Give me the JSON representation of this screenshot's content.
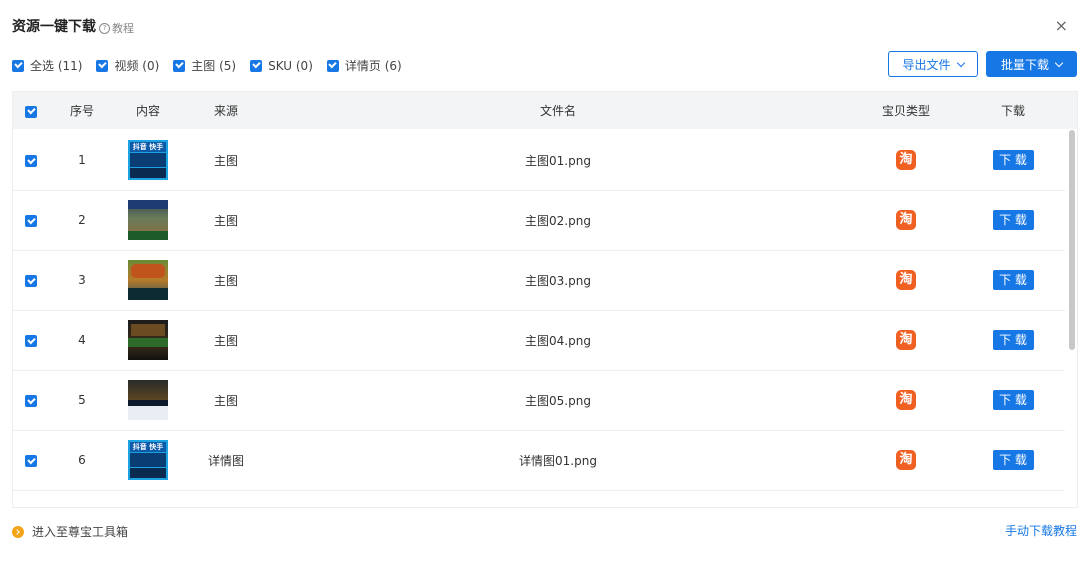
{
  "header": {
    "title": "资源一键下载",
    "help_label": "教程",
    "close_glyph": "×"
  },
  "filters": [
    {
      "label": "全选 (11)",
      "checked": true
    },
    {
      "label": "视频 (0)",
      "checked": true
    },
    {
      "label": "主图 (5)",
      "checked": true
    },
    {
      "label": "SKU (0)",
      "checked": true
    },
    {
      "label": "详情页 (6)",
      "checked": true
    }
  ],
  "toolbar": {
    "export_label": "导出文件",
    "batch_label": "批量下载"
  },
  "table": {
    "columns": [
      "序号",
      "内容",
      "来源",
      "文件名",
      "宝贝类型",
      "下载"
    ],
    "rows": [
      {
        "index": "1",
        "thumb": "promo-blue",
        "source": "主图",
        "filename": "主图01.png",
        "type_icon": "淘",
        "download": "下 载"
      },
      {
        "index": "2",
        "thumb": "photo-scene",
        "source": "主图",
        "filename": "主图02.png",
        "type_icon": "淘",
        "download": "下 载"
      },
      {
        "index": "3",
        "thumb": "food-scene",
        "source": "主图",
        "filename": "主图03.png",
        "type_icon": "淘",
        "download": "下 载"
      },
      {
        "index": "4",
        "thumb": "dark-scene",
        "source": "主图",
        "filename": "主图04.png",
        "type_icon": "淘",
        "download": "下 载"
      },
      {
        "index": "5",
        "thumb": "board-scene",
        "source": "主图",
        "filename": "主图05.png",
        "type_icon": "淘",
        "download": "下 载"
      },
      {
        "index": "6",
        "thumb": "promo-blue",
        "source": "详情图",
        "filename": "详情图01.png",
        "type_icon": "淘",
        "download": "下 载"
      }
    ]
  },
  "footer": {
    "toolbox_link": "进入至尊宝工具箱",
    "manual_link": "手动下载教程"
  },
  "colors": {
    "accent": "#1677e5",
    "taobao": "#f06022",
    "toolbox_icon": "#f4a417"
  }
}
